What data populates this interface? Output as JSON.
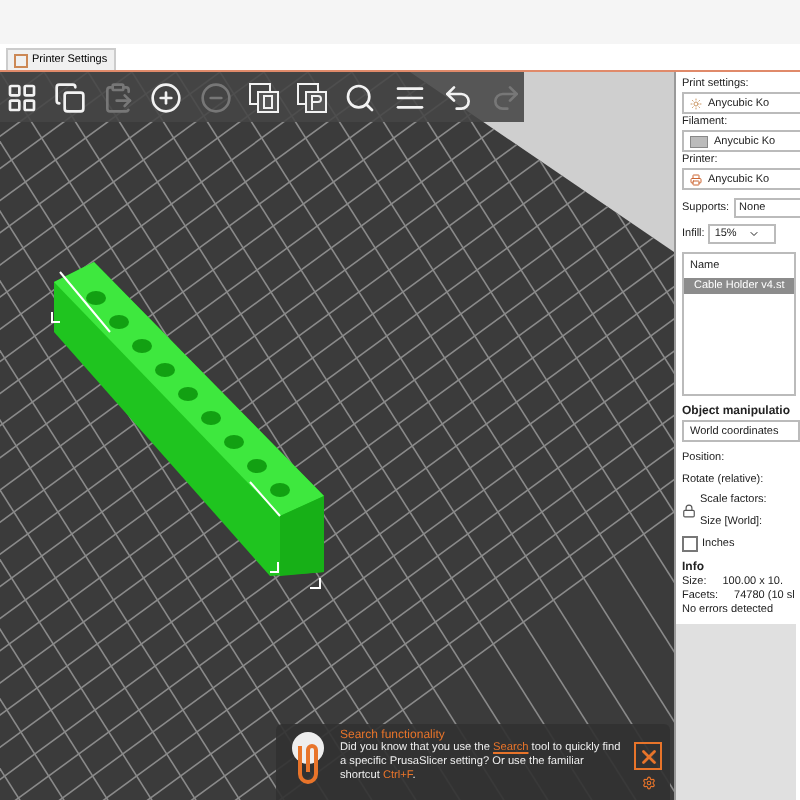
{
  "tabs": [
    {
      "label": "Printer Settings",
      "selected": true
    }
  ],
  "toolbar": [
    {
      "kind": "arrange",
      "disabled": false
    },
    {
      "kind": "copy",
      "disabled": false
    },
    {
      "kind": "paste",
      "disabled": true
    },
    {
      "kind": "add",
      "disabled": false
    },
    {
      "kind": "remove",
      "disabled": true
    },
    {
      "kind": "variable-height",
      "disabled": false
    },
    {
      "kind": "print-settings",
      "disabled": false
    },
    {
      "kind": "search",
      "disabled": false
    },
    {
      "kind": "layers",
      "disabled": false
    },
    {
      "kind": "undo",
      "disabled": false
    },
    {
      "kind": "redo",
      "disabled": true
    }
  ],
  "sidebar": {
    "presets": [
      {
        "kind": "print",
        "label": "Print settings:",
        "value": "Anycubic Ko"
      },
      {
        "kind": "filament",
        "label": "Filament:",
        "value": "Anycubic Ko"
      },
      {
        "kind": "printer",
        "label": "Printer:",
        "value": "Anycubic Ko"
      }
    ],
    "supports": {
      "label": "Supports:",
      "value": "None"
    },
    "infill": {
      "label": "Infill:",
      "value": "15%"
    },
    "object_list": {
      "columns": [
        "Name"
      ],
      "rows": [
        {
          "name": "Cable Holder v4.st",
          "selected": true
        }
      ]
    },
    "object_manipulation": {
      "title": "Object manipulatio",
      "coordinates": "World coordinates",
      "fields": [
        "Position:",
        "Rotate (relative):"
      ],
      "scale_label": "Scale factors:",
      "size_label": "Size [World]:",
      "inches": {
        "label": "Inches",
        "checked": false
      }
    },
    "info": {
      "title": "Info",
      "rows": [
        {
          "label": "Size:",
          "value": "100.00 x 10."
        },
        {
          "label": "Facets:",
          "value": "74780 (10 sl"
        }
      ],
      "status": "No errors detected"
    }
  },
  "notification": {
    "title": "Search functionality",
    "body": [
      {
        "text": "Did you know that you use the ",
        "kind": "text"
      },
      {
        "text": "Search",
        "kind": "link"
      },
      {
        "text": " tool to quickly find a specific PrusaSlicer setting? Or use the familiar shortcut ",
        "kind": "text"
      },
      {
        "text": "Ctrl+F",
        "kind": "shortcut"
      },
      {
        "text": ".",
        "kind": "text"
      }
    ]
  }
}
